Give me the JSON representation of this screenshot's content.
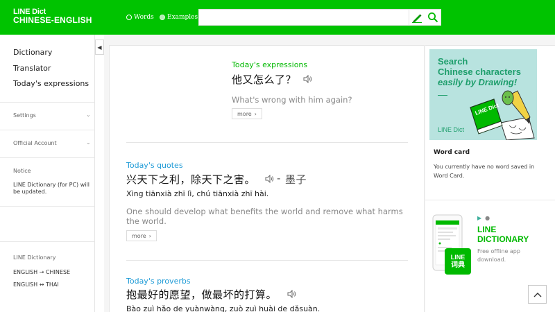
{
  "header": {
    "logo_line1": "LINE Dict",
    "logo_line2": "CHINESE-ENGLISH",
    "radio_words": "Words",
    "radio_examples": "Examples",
    "search_value": "",
    "accent_color": "#00c300"
  },
  "sidebar": {
    "nav": [
      "Dictionary",
      "Translator",
      "Today's expressions"
    ],
    "settings": "Settings",
    "official_account": "Official Account",
    "notice_title": "Notice",
    "notice_text": "LINE Dictionary (for PC) will be updated.",
    "footer_title": "LINE Dictionary",
    "lang1_from": "ENGLISH",
    "lang1_arrow": "→",
    "lang1_to": "CHINESE",
    "lang2_from": "ENGLISH",
    "lang2_arrow": "↔",
    "lang2_to": "THAI"
  },
  "main": {
    "expressions": {
      "label": "Today's expressions",
      "chinese": "他又怎么了？",
      "english": "What's wrong with him again?",
      "more": "more"
    },
    "quotes": {
      "label": "Today's quotes",
      "chinese": "兴天下之利，除天下之害。",
      "separator": "-",
      "author": "墨子",
      "pinyin": "Xìng tiānxià zhī lì, chú tiānxià zhī hài.",
      "english": "One should develop what benefits the world and remove what harms the world.",
      "more": "more"
    },
    "proverbs": {
      "label": "Today's proverbs",
      "chinese": "抱最好的愿望，做最坏的打算。",
      "pinyin": "Bào zuì hǎo de yuànwàng, zuò zuì huài de dǎsuàn."
    }
  },
  "right": {
    "ad_line1": "Search",
    "ad_line2": "Chinese characters",
    "ad_line3": "easily by Drawing!",
    "ad_book_text": "LINE Dict",
    "ad_brand": "LINE Dict",
    "word_card_title": "Word card",
    "word_card_text": "You currently have no word saved in Word Card.",
    "app_title_1": "LINE",
    "app_title_2": "DICTIONARY",
    "app_desc": "Free offline app download.",
    "app_badge_1": "LINE",
    "app_badge_2": "词典"
  }
}
